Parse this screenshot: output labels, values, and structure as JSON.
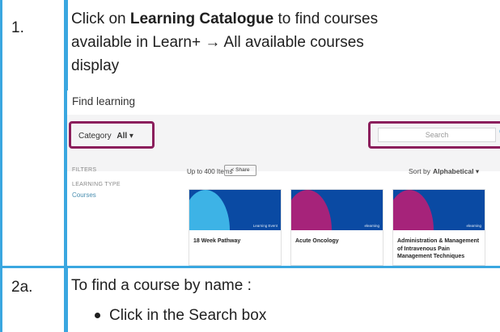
{
  "step1": {
    "number": "1.",
    "line1_pre": "Click on ",
    "line1_bold": "Learning Catalogue",
    "line1_post": " to find courses",
    "line2_pre": "available in Learn+ ",
    "line2_arrow": "→",
    "line2_post": " All available courses",
    "line3": "display"
  },
  "screenshot": {
    "title": "Find learning",
    "category_label": "Category",
    "category_value": "All",
    "category_caret": "▾",
    "search_placeholder": "Search",
    "search_icon": "Q",
    "filters_label": "FILTERS",
    "learning_type_label": "LEARNING TYPE",
    "courses_link": "Courses",
    "items_count": "Up to 400 Items",
    "share_label": "< Share",
    "sort_label": "Sort by",
    "sort_value": "Alphabetical",
    "sort_caret": "▾",
    "cards": [
      {
        "type": "Learning Event",
        "title": "18 Week Pathway",
        "accent": "#3db3e6"
      },
      {
        "type": "elearning",
        "title": "Acute Oncology",
        "accent": "#a6237a"
      },
      {
        "type": "elearning",
        "title": "Administration & Management of Intravenous Pain Management Techniques",
        "accent": "#a6237a"
      }
    ]
  },
  "step2a": {
    "number": "2a.",
    "intro": "To find a course by name :",
    "bullet": "Click in the Search box"
  },
  "colors": {
    "border_blue": "#3aa7e0",
    "highlight_maroon": "#8b1e5c",
    "banner_blue": "#0a4aa3"
  }
}
